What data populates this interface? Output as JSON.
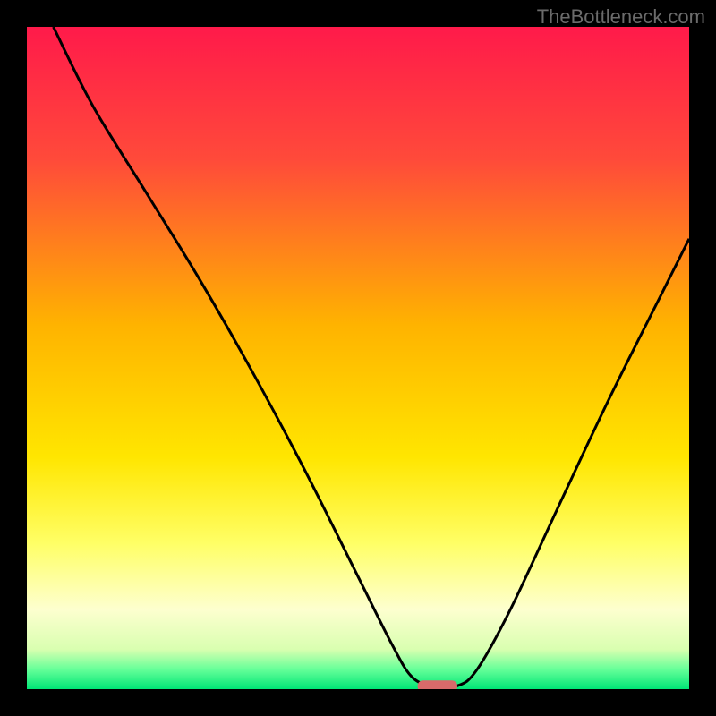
{
  "watermark": "TheBottleneck.com",
  "chart_data": {
    "type": "line",
    "title": "",
    "xlabel": "",
    "ylabel": "",
    "xlim": [
      0,
      100
    ],
    "ylim": [
      0,
      100
    ],
    "gradient_stops": [
      {
        "offset": 0,
        "color": "#ff1a4a"
      },
      {
        "offset": 20,
        "color": "#ff4a3a"
      },
      {
        "offset": 45,
        "color": "#ffb300"
      },
      {
        "offset": 65,
        "color": "#ffe600"
      },
      {
        "offset": 78,
        "color": "#ffff66"
      },
      {
        "offset": 88,
        "color": "#fdffcf"
      },
      {
        "offset": 94,
        "color": "#d9ffb0"
      },
      {
        "offset": 97,
        "color": "#66ff99"
      },
      {
        "offset": 100,
        "color": "#00e676"
      }
    ],
    "series": [
      {
        "name": "bottleneck-curve",
        "color": "#000000",
        "points": [
          {
            "x": 4,
            "y": 100
          },
          {
            "x": 10,
            "y": 88
          },
          {
            "x": 18,
            "y": 75
          },
          {
            "x": 26,
            "y": 62
          },
          {
            "x": 34,
            "y": 48
          },
          {
            "x": 42,
            "y": 33
          },
          {
            "x": 50,
            "y": 17
          },
          {
            "x": 55,
            "y": 7
          },
          {
            "x": 58,
            "y": 2
          },
          {
            "x": 61,
            "y": 0.5
          },
          {
            "x": 65,
            "y": 0.5
          },
          {
            "x": 68,
            "y": 3
          },
          {
            "x": 73,
            "y": 12
          },
          {
            "x": 80,
            "y": 27
          },
          {
            "x": 88,
            "y": 44
          },
          {
            "x": 96,
            "y": 60
          },
          {
            "x": 100,
            "y": 68
          }
        ]
      }
    ],
    "marker": {
      "x": 62,
      "y": 0.5,
      "width": 6,
      "color": "#d86a6a"
    }
  }
}
